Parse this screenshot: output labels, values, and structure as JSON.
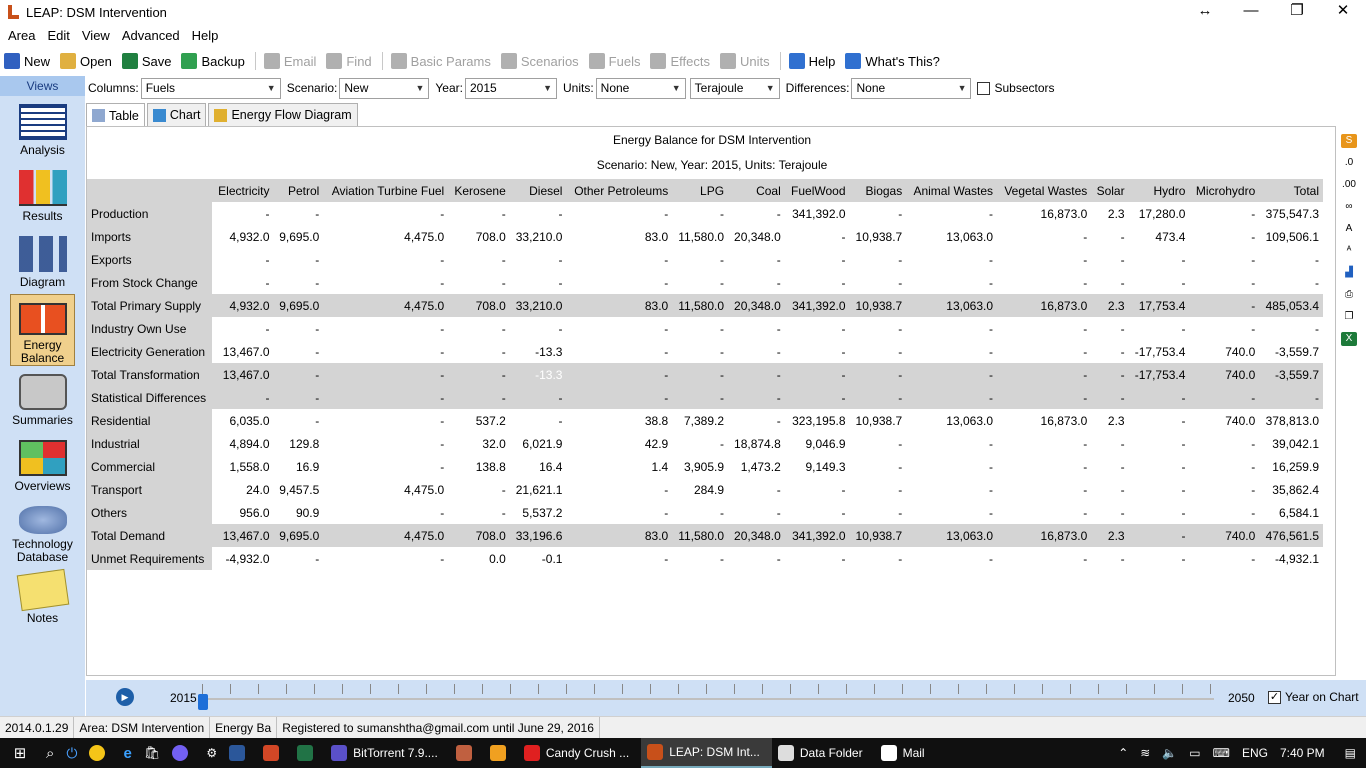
{
  "window": {
    "title": "LEAP: DSM Intervention"
  },
  "menu": [
    "Area",
    "Edit",
    "View",
    "Advanced",
    "Help"
  ],
  "toolbar": [
    {
      "label": "New",
      "enabled": true,
      "icon": "new-icon",
      "color": "#3060c0"
    },
    {
      "label": "Open",
      "enabled": true,
      "icon": "open-icon",
      "color": "#e0b040"
    },
    {
      "label": "Save",
      "enabled": true,
      "icon": "save-icon",
      "color": "#208040"
    },
    {
      "label": "Backup",
      "enabled": true,
      "icon": "backup-icon",
      "color": "#30a050"
    },
    {
      "label": "Email",
      "enabled": false,
      "icon": "email-icon",
      "color": "#b0b0b0"
    },
    {
      "label": "Find",
      "enabled": false,
      "icon": "find-icon",
      "color": "#b0b0b0"
    },
    {
      "label": "Basic Params",
      "enabled": false,
      "icon": "basic-params-icon",
      "color": "#b0b0b0"
    },
    {
      "label": "Scenarios",
      "enabled": false,
      "icon": "scenarios-icon",
      "color": "#b0b0b0"
    },
    {
      "label": "Fuels",
      "enabled": false,
      "icon": "fuels-icon",
      "color": "#b0b0b0"
    },
    {
      "label": "Effects",
      "enabled": false,
      "icon": "effects-icon",
      "color": "#b0b0b0"
    },
    {
      "label": "Units",
      "enabled": false,
      "icon": "units-icon",
      "color": "#b0b0b0"
    },
    {
      "label": "Help",
      "enabled": true,
      "icon": "help-icon",
      "color": "#3070d0"
    },
    {
      "label": "What's This?",
      "enabled": true,
      "icon": "whats-this-icon",
      "color": "#3070d0"
    }
  ],
  "sidebar": {
    "header": "Views",
    "items": [
      {
        "label": "Analysis",
        "active": false
      },
      {
        "label": "Results",
        "active": false
      },
      {
        "label": "Diagram",
        "active": false
      },
      {
        "label": "Energy\nBalance",
        "active": true
      },
      {
        "label": "Summaries",
        "active": false
      },
      {
        "label": "Overviews",
        "active": false
      },
      {
        "label": "Technology\nDatabase",
        "active": false
      },
      {
        "label": "Notes",
        "active": false
      }
    ]
  },
  "options": {
    "columns_label": "Columns:",
    "columns_value": "Fuels",
    "scenario_label": "Scenario:",
    "scenario_value": "New",
    "year_label": "Year:",
    "year_value": "2015",
    "units_label": "Units:",
    "units_value": "None",
    "unit2_value": "Terajoule",
    "diff_label": "Differences:",
    "diff_value": "None",
    "subsectors_label": "Subsectors"
  },
  "tabs": [
    {
      "label": "Table",
      "active": true
    },
    {
      "label": "Chart",
      "active": false
    },
    {
      "label": "Energy Flow Diagram",
      "active": false
    }
  ],
  "report": {
    "title": "Energy Balance for DSM Intervention",
    "subtitle": "Scenario: New, Year: 2015, Units: Terajoule"
  },
  "table": {
    "columns": [
      "Electricity",
      "Petrol",
      "Aviation Turbine Fuel",
      "Kerosene",
      "Diesel",
      "Other Petroleums",
      "LPG",
      "Coal",
      "FuelWood",
      "Biogas",
      "Animal Wastes",
      "Vegetal Wastes",
      "Solar",
      "Hydro",
      "Microhydro",
      "Total"
    ],
    "rows": [
      {
        "label": "Production",
        "total": false,
        "values": [
          "-",
          "-",
          "-",
          "-",
          "-",
          "-",
          "-",
          "-",
          "341,392.0",
          "-",
          "-",
          "16,873.0",
          "2.3",
          "17,280.0",
          "-",
          "375,547.3"
        ]
      },
      {
        "label": "Imports",
        "total": false,
        "values": [
          "4,932.0",
          "9,695.0",
          "4,475.0",
          "708.0",
          "33,210.0",
          "83.0",
          "11,580.0",
          "20,348.0",
          "-",
          "10,938.7",
          "13,063.0",
          "-",
          "-",
          "473.4",
          "-",
          "109,506.1"
        ]
      },
      {
        "label": "Exports",
        "total": false,
        "values": [
          "-",
          "-",
          "-",
          "-",
          "-",
          "-",
          "-",
          "-",
          "-",
          "-",
          "-",
          "-",
          "-",
          "-",
          "-",
          "-"
        ]
      },
      {
        "label": "From Stock Change",
        "total": false,
        "values": [
          "-",
          "-",
          "-",
          "-",
          "-",
          "-",
          "-",
          "-",
          "-",
          "-",
          "-",
          "-",
          "-",
          "-",
          "-",
          "-"
        ]
      },
      {
        "label": "Total Primary Supply",
        "total": true,
        "values": [
          "4,932.0",
          "9,695.0",
          "4,475.0",
          "708.0",
          "33,210.0",
          "83.0",
          "11,580.0",
          "20,348.0",
          "341,392.0",
          "10,938.7",
          "13,063.0",
          "16,873.0",
          "2.3",
          "17,753.4",
          "-",
          "485,053.4"
        ]
      },
      {
        "label": "Industry Own Use",
        "total": false,
        "values": [
          "-",
          "-",
          "-",
          "-",
          "-",
          "-",
          "-",
          "-",
          "-",
          "-",
          "-",
          "-",
          "-",
          "-",
          "-",
          "-"
        ]
      },
      {
        "label": "Electricity Generation",
        "total": false,
        "values": [
          "13,467.0",
          "-",
          "-",
          "-",
          "-13.3",
          "-",
          "-",
          "-",
          "-",
          "-",
          "-",
          "-",
          "-",
          "-17,753.4",
          "740.0",
          "-3,559.7"
        ]
      },
      {
        "label": "Total Transformation",
        "total": true,
        "values": [
          "13,467.0",
          "-",
          "-",
          "-",
          "-13.3",
          "-",
          "-",
          "-",
          "-",
          "-",
          "-",
          "-",
          "-",
          "-17,753.4",
          "740.0",
          "-3,559.7"
        ]
      },
      {
        "label": "Statistical Differences",
        "total": true,
        "values": [
          "-",
          "-",
          "-",
          "-",
          "-",
          "-",
          "-",
          "-",
          "-",
          "-",
          "-",
          "-",
          "-",
          "-",
          "-",
          "-"
        ]
      },
      {
        "label": "Residential",
        "total": false,
        "values": [
          "6,035.0",
          "-",
          "-",
          "537.2",
          "-",
          "38.8",
          "7,389.2",
          "-",
          "323,195.8",
          "10,938.7",
          "13,063.0",
          "16,873.0",
          "2.3",
          "-",
          "740.0",
          "378,813.0"
        ]
      },
      {
        "label": "Industrial",
        "total": false,
        "values": [
          "4,894.0",
          "129.8",
          "-",
          "32.0",
          "6,021.9",
          "42.9",
          "-",
          "18,874.8",
          "9,046.9",
          "-",
          "-",
          "-",
          "-",
          "-",
          "-",
          "39,042.1"
        ]
      },
      {
        "label": "Commercial",
        "total": false,
        "values": [
          "1,558.0",
          "16.9",
          "-",
          "138.8",
          "16.4",
          "1.4",
          "3,905.9",
          "1,473.2",
          "9,149.3",
          "-",
          "-",
          "-",
          "-",
          "-",
          "-",
          "16,259.9"
        ]
      },
      {
        "label": "Transport",
        "total": false,
        "values": [
          "24.0",
          "9,457.5",
          "4,475.0",
          "-",
          "21,621.1",
          "-",
          "284.9",
          "-",
          "-",
          "-",
          "-",
          "-",
          "-",
          "-",
          "-",
          "35,862.4"
        ]
      },
      {
        "label": "Others",
        "total": false,
        "values": [
          "956.0",
          "90.9",
          "-",
          "-",
          "5,537.2",
          "-",
          "-",
          "-",
          "-",
          "-",
          "-",
          "-",
          "-",
          "-",
          "-",
          "6,584.1"
        ]
      },
      {
        "label": "Total Demand",
        "total": true,
        "values": [
          "13,467.0",
          "9,695.0",
          "4,475.0",
          "708.0",
          "33,196.6",
          "83.0",
          "11,580.0",
          "20,348.0",
          "341,392.0",
          "10,938.7",
          "13,063.0",
          "16,873.0",
          "2.3",
          "-",
          "740.0",
          "476,561.5"
        ]
      },
      {
        "label": "Unmet Requirements",
        "total": false,
        "values": [
          "-4,932.0",
          "-",
          "-",
          "0.0",
          "-0.1",
          "-",
          "-",
          "-",
          "-",
          "-",
          "-",
          "-",
          "-",
          "-",
          "-",
          "-4,932.1"
        ]
      }
    ],
    "selected": {
      "row": 7,
      "col": 4
    }
  },
  "timeline": {
    "start": "2015",
    "end": "2050",
    "year_on_chart_label": "Year on Chart",
    "year_on_chart_checked": true
  },
  "status": [
    "2014.0.1.29",
    "Area: DSM Intervention",
    "Energy Ba",
    "Registered to sumanshtha@gmail.com until June 29, 2016"
  ],
  "taskbar": {
    "items": [
      {
        "label": "BitTorrent 7.9....",
        "active": false,
        "color": "#5a50c8"
      },
      {
        "label": "",
        "active": false,
        "color": "#c06040"
      },
      {
        "label": "",
        "active": false,
        "color": "#f0a020"
      },
      {
        "label": "Candy Crush ...",
        "active": false,
        "color": "#e02020"
      },
      {
        "label": "LEAP: DSM Int...",
        "active": true,
        "color": "#c8501a"
      },
      {
        "label": "Data Folder",
        "active": false,
        "color": "#dddddd"
      },
      {
        "label": "Mail",
        "active": false,
        "color": "#ffffff"
      }
    ],
    "lang": "ENG",
    "time": "7:40 PM"
  }
}
